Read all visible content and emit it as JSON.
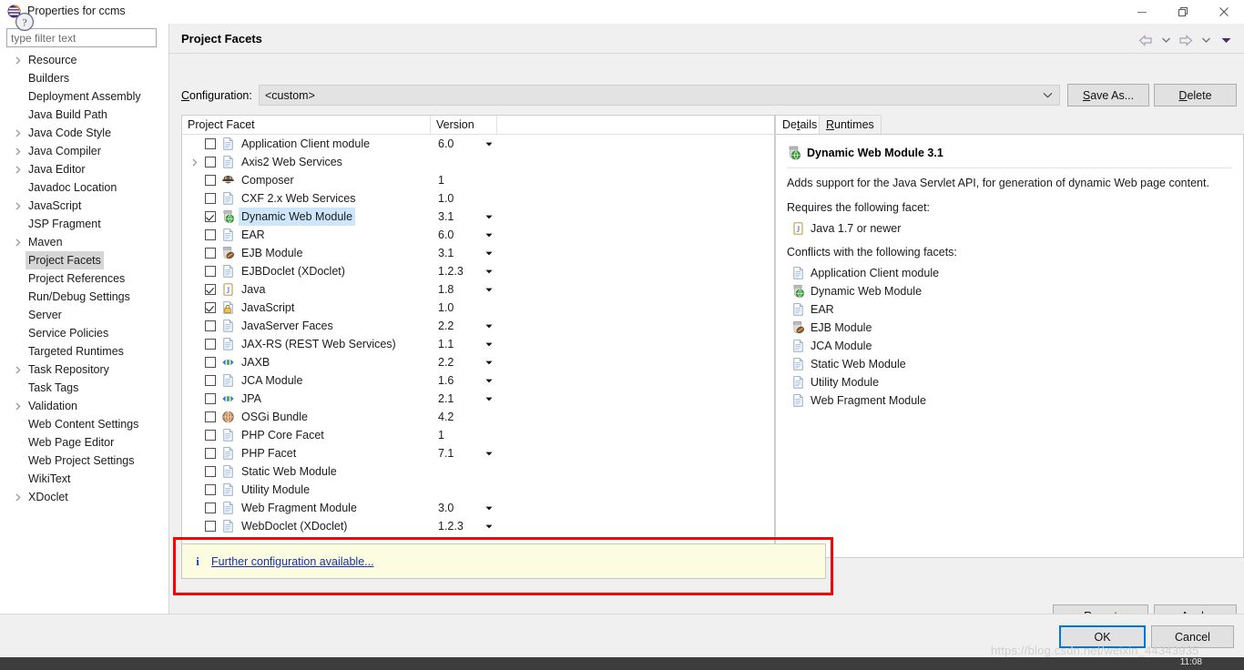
{
  "window": {
    "title": "Properties for ccms",
    "icon": "eclipse-icon",
    "minimize": "minimize-icon",
    "maximize": "restore-icon",
    "close": "close-icon"
  },
  "sidebar": {
    "filter_placeholder": "type filter text",
    "filter_value": "",
    "items": [
      {
        "label": "Resource",
        "expandable": true,
        "selected": false
      },
      {
        "label": "Builders",
        "expandable": false,
        "selected": false
      },
      {
        "label": "Deployment Assembly",
        "expandable": false,
        "selected": false
      },
      {
        "label": "Java Build Path",
        "expandable": false,
        "selected": false
      },
      {
        "label": "Java Code Style",
        "expandable": true,
        "selected": false
      },
      {
        "label": "Java Compiler",
        "expandable": true,
        "selected": false
      },
      {
        "label": "Java Editor",
        "expandable": true,
        "selected": false
      },
      {
        "label": "Javadoc Location",
        "expandable": false,
        "selected": false
      },
      {
        "label": "JavaScript",
        "expandable": true,
        "selected": false
      },
      {
        "label": "JSP Fragment",
        "expandable": false,
        "selected": false
      },
      {
        "label": "Maven",
        "expandable": true,
        "selected": false
      },
      {
        "label": "Project Facets",
        "expandable": false,
        "selected": true
      },
      {
        "label": "Project References",
        "expandable": false,
        "selected": false
      },
      {
        "label": "Run/Debug Settings",
        "expandable": false,
        "selected": false
      },
      {
        "label": "Server",
        "expandable": false,
        "selected": false
      },
      {
        "label": "Service Policies",
        "expandable": false,
        "selected": false
      },
      {
        "label": "Targeted Runtimes",
        "expandable": false,
        "selected": false
      },
      {
        "label": "Task Repository",
        "expandable": true,
        "selected": false
      },
      {
        "label": "Task Tags",
        "expandable": false,
        "selected": false
      },
      {
        "label": "Validation",
        "expandable": true,
        "selected": false
      },
      {
        "label": "Web Content Settings",
        "expandable": false,
        "selected": false
      },
      {
        "label": "Web Page Editor",
        "expandable": false,
        "selected": false
      },
      {
        "label": "Web Project Settings",
        "expandable": false,
        "selected": false
      },
      {
        "label": "WikiText",
        "expandable": false,
        "selected": false
      },
      {
        "label": "XDoclet",
        "expandable": true,
        "selected": false
      }
    ]
  },
  "main": {
    "page_title": "Project Facets",
    "nav": {
      "back_icon": "back-arrow-icon",
      "back_menu_icon": "chevron-down-icon",
      "forward_icon": "forward-arrow-icon",
      "forward_menu_icon": "chevron-down-icon",
      "menu_icon": "view-menu-icon"
    },
    "configuration": {
      "label": "Configuration:",
      "mnemonic": "C",
      "label_rest": "onfiguration:",
      "value": "<custom>",
      "caret_icon": "chevron-down-icon"
    },
    "save_as_button": {
      "mnemonic": "S",
      "rest": "ave As..."
    },
    "delete_button": {
      "mnemonic": "D",
      "rest": "elete"
    },
    "table": {
      "columns": [
        "Project Facet",
        "Version"
      ],
      "rows": [
        {
          "name": "Application Client module",
          "version": "6.0",
          "checked": false,
          "expandable": false,
          "selected": false,
          "has_version_menu": true,
          "icon": "document-icon"
        },
        {
          "name": "Axis2 Web Services",
          "version": "",
          "checked": false,
          "expandable": true,
          "selected": false,
          "has_version_menu": false,
          "icon": "document-icon"
        },
        {
          "name": "Composer",
          "version": "1",
          "checked": false,
          "expandable": false,
          "selected": false,
          "has_version_menu": false,
          "icon": "composer-icon"
        },
        {
          "name": "CXF 2.x Web Services",
          "version": "1.0",
          "checked": false,
          "expandable": false,
          "selected": false,
          "has_version_menu": false,
          "icon": "document-icon"
        },
        {
          "name": "Dynamic Web Module",
          "version": "3.1",
          "checked": true,
          "expandable": false,
          "selected": true,
          "has_version_menu": true,
          "icon": "web-module-icon"
        },
        {
          "name": "EAR",
          "version": "6.0",
          "checked": false,
          "expandable": false,
          "selected": false,
          "has_version_menu": true,
          "icon": "document-icon"
        },
        {
          "name": "EJB Module",
          "version": "3.1",
          "checked": false,
          "expandable": false,
          "selected": false,
          "has_version_menu": true,
          "icon": "ejb-module-icon"
        },
        {
          "name": "EJBDoclet (XDoclet)",
          "version": "1.2.3",
          "checked": false,
          "expandable": false,
          "selected": false,
          "has_version_menu": true,
          "icon": "document-icon"
        },
        {
          "name": "Java",
          "version": "1.8",
          "checked": true,
          "expandable": false,
          "selected": false,
          "has_version_menu": true,
          "icon": "java-icon"
        },
        {
          "name": "JavaScript",
          "version": "1.0",
          "checked": true,
          "expandable": false,
          "selected": false,
          "has_version_menu": false,
          "icon": "javascript-icon"
        },
        {
          "name": "JavaServer Faces",
          "version": "2.2",
          "checked": false,
          "expandable": false,
          "selected": false,
          "has_version_menu": true,
          "icon": "document-icon"
        },
        {
          "name": "JAX-RS (REST Web Services)",
          "version": "1.1",
          "checked": false,
          "expandable": false,
          "selected": false,
          "has_version_menu": true,
          "icon": "document-icon"
        },
        {
          "name": "JAXB",
          "version": "2.2",
          "checked": false,
          "expandable": false,
          "selected": false,
          "has_version_menu": true,
          "icon": "jaxb-icon"
        },
        {
          "name": "JCA Module",
          "version": "1.6",
          "checked": false,
          "expandable": false,
          "selected": false,
          "has_version_menu": true,
          "icon": "document-icon"
        },
        {
          "name": "JPA",
          "version": "2.1",
          "checked": false,
          "expandable": false,
          "selected": false,
          "has_version_menu": true,
          "icon": "jaxb-icon"
        },
        {
          "name": "OSGi Bundle",
          "version": "4.2",
          "checked": false,
          "expandable": false,
          "selected": false,
          "has_version_menu": false,
          "icon": "osgi-icon"
        },
        {
          "name": "PHP Core Facet",
          "version": "1",
          "checked": false,
          "expandable": false,
          "selected": false,
          "has_version_menu": false,
          "icon": "document-icon"
        },
        {
          "name": "PHP Facet",
          "version": "7.1",
          "checked": false,
          "expandable": false,
          "selected": false,
          "has_version_menu": true,
          "icon": "document-icon"
        },
        {
          "name": "Static Web Module",
          "version": "",
          "checked": false,
          "expandable": false,
          "selected": false,
          "has_version_menu": false,
          "icon": "document-icon"
        },
        {
          "name": "Utility Module",
          "version": "",
          "checked": false,
          "expandable": false,
          "selected": false,
          "has_version_menu": false,
          "icon": "document-icon"
        },
        {
          "name": "Web Fragment Module",
          "version": "3.0",
          "checked": false,
          "expandable": false,
          "selected": false,
          "has_version_menu": true,
          "icon": "document-icon"
        },
        {
          "name": "WebDoclet (XDoclet)",
          "version": "1.2.3",
          "checked": false,
          "expandable": false,
          "selected": false,
          "has_version_menu": true,
          "icon": "document-icon"
        }
      ]
    },
    "details": {
      "tabs": [
        {
          "label": "Details",
          "mnemonic_index": 3,
          "active": true
        },
        {
          "label": "Runtimes",
          "mnemonic_index": 0,
          "active": false
        }
      ],
      "facet_title": "Dynamic Web Module 3.1",
      "facet_icon": "web-module-icon",
      "description": "Adds support for the Java Servlet API, for generation of dynamic Web page content.",
      "requires_heading": "Requires the following facet:",
      "requires": [
        {
          "label": "Java 1.7 or newer",
          "icon": "java-icon"
        }
      ],
      "conflicts_heading": "Conflicts with the following facets:",
      "conflicts": [
        {
          "label": "Application Client module",
          "icon": "document-icon"
        },
        {
          "label": "Dynamic Web Module",
          "icon": "web-module-icon"
        },
        {
          "label": "EAR",
          "icon": "document-icon"
        },
        {
          "label": "EJB Module",
          "icon": "ejb-module-icon"
        },
        {
          "label": "JCA Module",
          "icon": "document-icon"
        },
        {
          "label": "Static Web Module",
          "icon": "document-icon"
        },
        {
          "label": "Utility Module",
          "icon": "document-icon"
        },
        {
          "label": "Web Fragment Module",
          "icon": "document-icon"
        }
      ]
    },
    "info_bar": {
      "icon": "info-icon",
      "link_text": "Further configuration available..."
    },
    "revert_button": "Revert",
    "apply_button": {
      "mnemonic": "A",
      "rest": "pply"
    }
  },
  "footer": {
    "help_icon": "help-icon",
    "ok_button": "OK",
    "cancel_button": "Cancel",
    "watermark": "https://blog.csdn.net/weixin_44343935",
    "taskbar_clock": "11:08"
  },
  "colors": {
    "selection_blue": "#cde6fb",
    "focus_blue": "#0078d7",
    "info_yellow": "#fcfce1",
    "highlight_red": "#ff0000",
    "link_blue": "#1630b8"
  }
}
